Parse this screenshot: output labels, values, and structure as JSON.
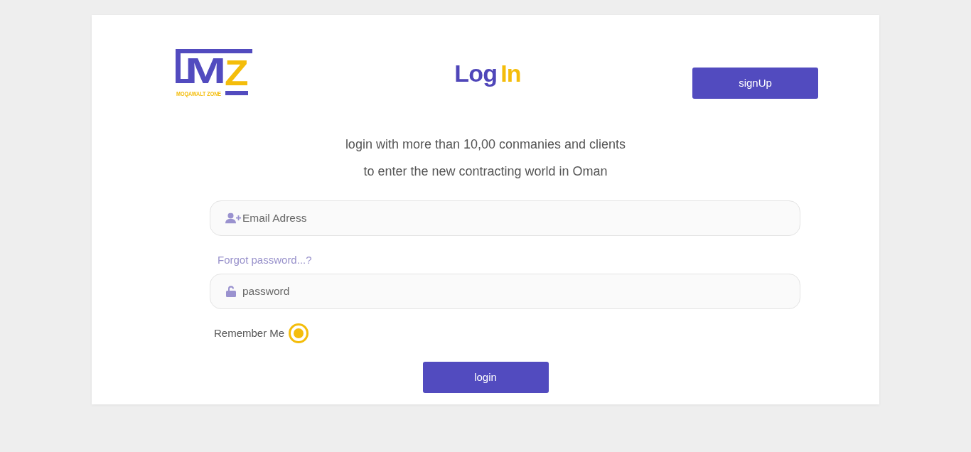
{
  "logo": {
    "letters": [
      "M",
      "Z"
    ],
    "tagline": "MOQAWALT ZONE"
  },
  "title": {
    "first": "Log",
    "second": "In"
  },
  "signup_button": "signUp",
  "intro": [
    "login with more than 10,00 conmanies and clients",
    "to enter the new contracting world in Oman"
  ],
  "email_field": {
    "placeholder": "Email Adress"
  },
  "forgot_link": "Forgot password...?",
  "password_field": {
    "placeholder": "password"
  },
  "remember_me": {
    "label": "Remember Me",
    "checked": true
  },
  "login_button": "login"
}
